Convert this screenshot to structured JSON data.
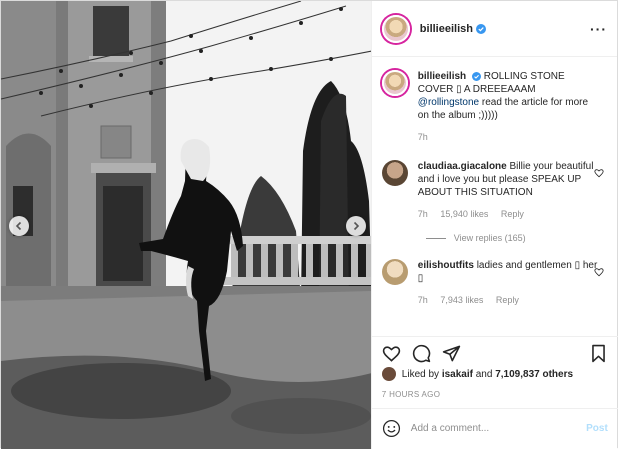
{
  "post": {
    "username": "billieeilish",
    "caption_username": "billieeilish",
    "caption_text_1": "ROLLING STONE COVER",
    "caption_emoji_1": "",
    "caption_text_2": "A DREEEAAAM",
    "caption_mention": "@rollingstone",
    "caption_text_3": "read the article for more on the album",
    "caption_text_4": ";)))))",
    "caption_time": "7h"
  },
  "comments": [
    {
      "username": "claudiaa.giacalone",
      "text": "Billie your beautiful and i love you but please SPEAK UP ABOUT THIS SITUATION",
      "time": "7h",
      "likes": "15,940 likes",
      "reply": "Reply",
      "view_replies": "View replies (165)"
    },
    {
      "username": "eilishoutfits",
      "text": "ladies and gentlemen",
      "text_end": "her",
      "time": "7h",
      "likes": "7,943 likes",
      "reply": "Reply"
    }
  ],
  "likes_line": {
    "prefix": "Liked by",
    "liker": "isakaif",
    "and": "and",
    "count": "7,109,837 others"
  },
  "timestamp": "7 HOURS AGO",
  "add_comment": {
    "placeholder": "Add a comment...",
    "post_label": "Post"
  },
  "icons": {
    "more": "more-options-icon",
    "like": "heart-icon",
    "comment": "comment-icon",
    "share": "share-icon",
    "save": "bookmark-icon",
    "emoji": "emoji-icon"
  },
  "colors": {
    "verified": "#3897f0",
    "link": "#00376b",
    "post_button": "#b2dffc",
    "ring": "#d6249f"
  }
}
